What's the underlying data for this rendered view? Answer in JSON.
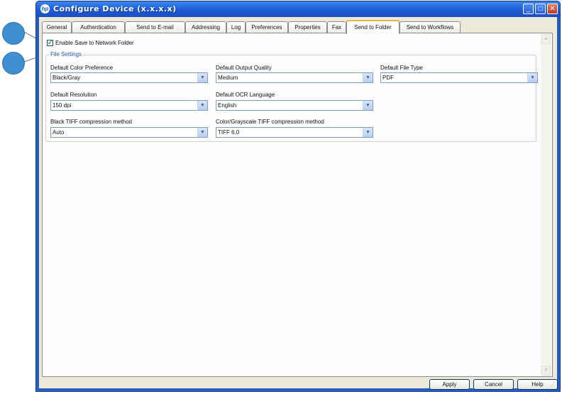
{
  "window": {
    "title": "Configure Device (x.x.x.x)",
    "logo": "hp"
  },
  "tabs": [
    {
      "label": "General"
    },
    {
      "label": "Authentication"
    },
    {
      "label": "Send to E-mail"
    },
    {
      "label": "Addressing"
    },
    {
      "label": "Log"
    },
    {
      "label": "Preferences"
    },
    {
      "label": "Properties"
    },
    {
      "label": "Fax"
    },
    {
      "label": "Send to Folder",
      "active": true
    },
    {
      "label": "Send to Workflows"
    }
  ],
  "enable_checkbox": {
    "label": "Enable Save to Network Folder",
    "checked": true
  },
  "file_settings": {
    "legend": "File Settings",
    "fields": [
      {
        "label": "Default Color Preference",
        "value": "Black/Gray"
      },
      {
        "label": "Default Output Quality",
        "value": "Medium"
      },
      {
        "label": "Default File Type",
        "value": "PDF"
      },
      {
        "label": "Default Resolution",
        "value": "150 dpi"
      },
      {
        "label": "Default OCR Language",
        "value": "English"
      },
      {
        "label": "Black TIFF compression method",
        "value": "Auto"
      },
      {
        "label": "Color/Grayscale TIFF compression method",
        "value": "TIFF 6.0"
      }
    ]
  },
  "buttons": {
    "apply": "Apply",
    "cancel": "Cancel",
    "help": "Help"
  },
  "colors": {
    "titlebar": "#1f5bd6",
    "callout": "#3f8fd0",
    "active_tab_accent": "#f2b33d",
    "legend": "#2357a8"
  }
}
